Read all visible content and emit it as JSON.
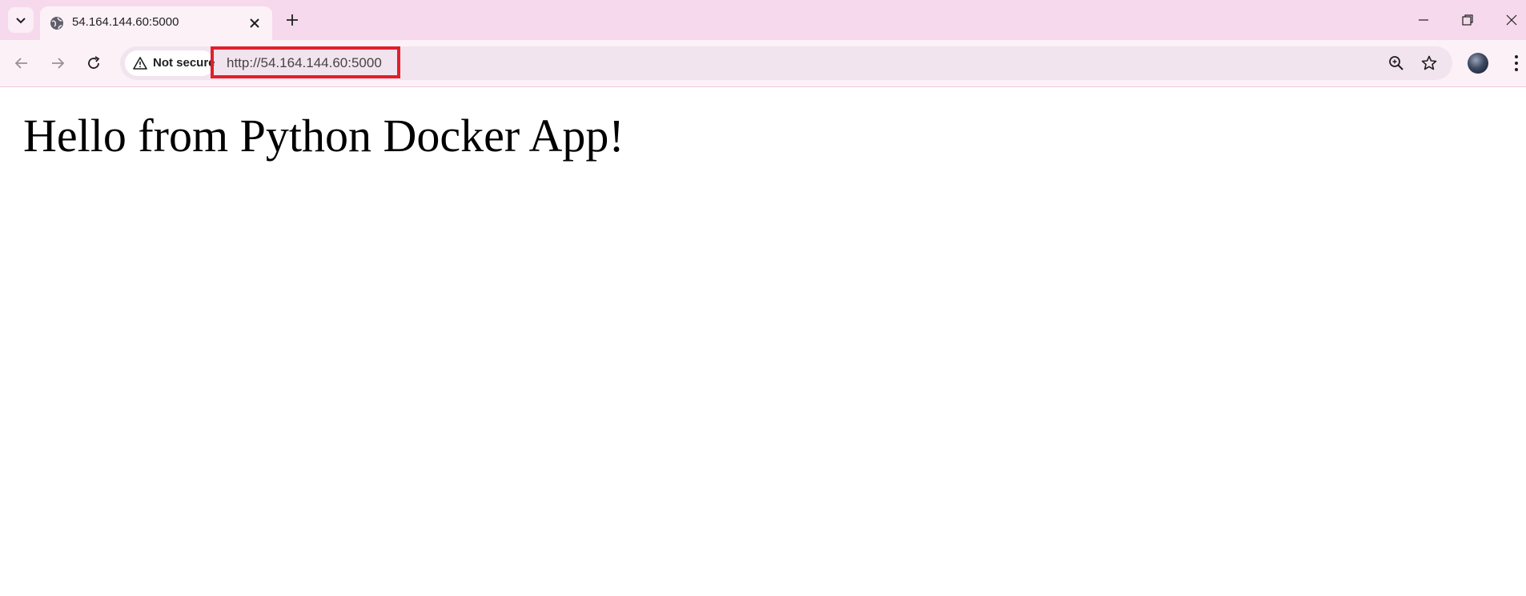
{
  "tab": {
    "title": "54.164.144.60:5000",
    "favicon": "globe-icon"
  },
  "toolbar": {
    "security_label": "Not secure",
    "url": "http://54.164.144.60:5000"
  },
  "page": {
    "heading": "Hello from Python Docker App!"
  },
  "colors": {
    "tabstrip_bg": "#f6d9ec",
    "toolbar_bg": "#fcf1f7",
    "highlight_border": "#e11f2b"
  },
  "icons": [
    "chevron-down-icon",
    "globe-icon",
    "close-icon",
    "plus-icon",
    "minimize-icon",
    "restore-icon",
    "window-close-icon",
    "back-arrow-icon",
    "forward-arrow-icon",
    "reload-icon",
    "warning-icon",
    "zoom-icon",
    "star-icon",
    "avatar",
    "more-vert-icon"
  ]
}
